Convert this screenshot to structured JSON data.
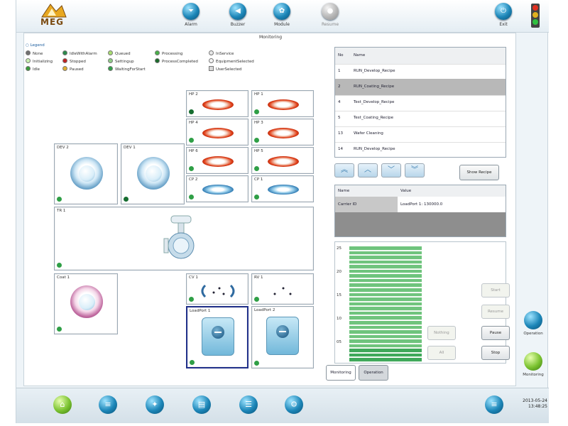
{
  "topbar": {
    "logo_text": "MEG",
    "buttons": [
      {
        "label": "Alarm",
        "icon": "alarm-icon"
      },
      {
        "label": "Buzzer",
        "icon": "buzzer-icon"
      },
      {
        "label": "Module",
        "icon": "module-icon"
      },
      {
        "label": "Resume",
        "icon": "resume-icon",
        "disabled": true
      },
      {
        "label": "Exit",
        "icon": "exit-icon"
      }
    ]
  },
  "main": {
    "title": "Monitoring",
    "legend": {
      "title": "Legend",
      "items": [
        {
          "label": "None",
          "color": "#707070"
        },
        {
          "label": "Initializing",
          "color": "#c8f0b0"
        },
        {
          "label": "Idle",
          "color": "#3a9c3a"
        },
        {
          "label": "IdleWithAlarm",
          "color": "#2a8a4a"
        },
        {
          "label": "Stopped",
          "color": "#c02020"
        },
        {
          "label": "Paused",
          "color": "#e0b030"
        },
        {
          "label": "Queued",
          "color": "#a8dc70"
        },
        {
          "label": "Settingup",
          "color": "#90cc88"
        },
        {
          "label": "WaitingForStart",
          "color": "#30a048"
        },
        {
          "label": "Processing",
          "color": "#48b048"
        },
        {
          "label": "ProcessCompleted",
          "color": "#1a6a2a"
        },
        {
          "label": "InService",
          "color": "#e8e8e8"
        },
        {
          "label": "EquipmentSelected",
          "color": "#f4f4f4"
        },
        {
          "label": "UserSelected",
          "color": "#d8d8d8"
        }
      ]
    },
    "modules": {
      "hp2": "HP 2",
      "hp1": "HP 1",
      "hp4": "HP 4",
      "hp3": "HP 3",
      "hp6": "HP 6",
      "hp5": "HP 5",
      "cp2": "CP 2",
      "cp1": "CP 1",
      "dev2": "DEV 2",
      "dev1": "DEV 1",
      "tr1": "TR 1",
      "coat1": "Coat 1",
      "cv1": "CV 1",
      "rv1": "RV 1",
      "loadport1": "LoadPort 1",
      "loadport2": "LoadPort 2"
    },
    "recipe_table": {
      "headers": [
        "No",
        "Name"
      ],
      "rows": [
        {
          "no": "1",
          "name": "RUN_Develop_Recipe"
        },
        {
          "no": "2",
          "name": "RUN_Coating_Recipe",
          "selected": true
        },
        {
          "no": "4",
          "name": "Test_Develop_Recipe"
        },
        {
          "no": "5",
          "name": "Test_Coating_Recipe"
        },
        {
          "no": "13",
          "name": "Wafer Cleaning"
        },
        {
          "no": "14",
          "name": "RUN_Develop_Recipe"
        }
      ]
    },
    "show_recipe_label": "Show Recipe",
    "properties": {
      "headers": [
        "Name",
        "Value"
      ],
      "rows": [
        {
          "name": "Carrier ID",
          "value": "LoadPort 1: 130000.0"
        }
      ]
    },
    "carrier": {
      "slot_labels": [
        "25",
        "20",
        "15",
        "10",
        "05"
      ],
      "slot_count": 25,
      "filled_slots": 25
    },
    "buttons": {
      "nothing": "Nothing",
      "all": "All",
      "start": "Start",
      "resume": "Resume",
      "pause": "Pause",
      "stop": "Stop"
    },
    "tabs": {
      "monitoring": "Monitoring",
      "operation": "Operation"
    }
  },
  "side": {
    "operation": "Operation",
    "monitoring": "Monitoring"
  },
  "clock": {
    "date": "2013-05-24",
    "time": "13:48:25"
  },
  "colors": {
    "accent": "#1c86b8",
    "slot_fill": "#6fc47d",
    "selected_row": "#b8b8b8"
  }
}
